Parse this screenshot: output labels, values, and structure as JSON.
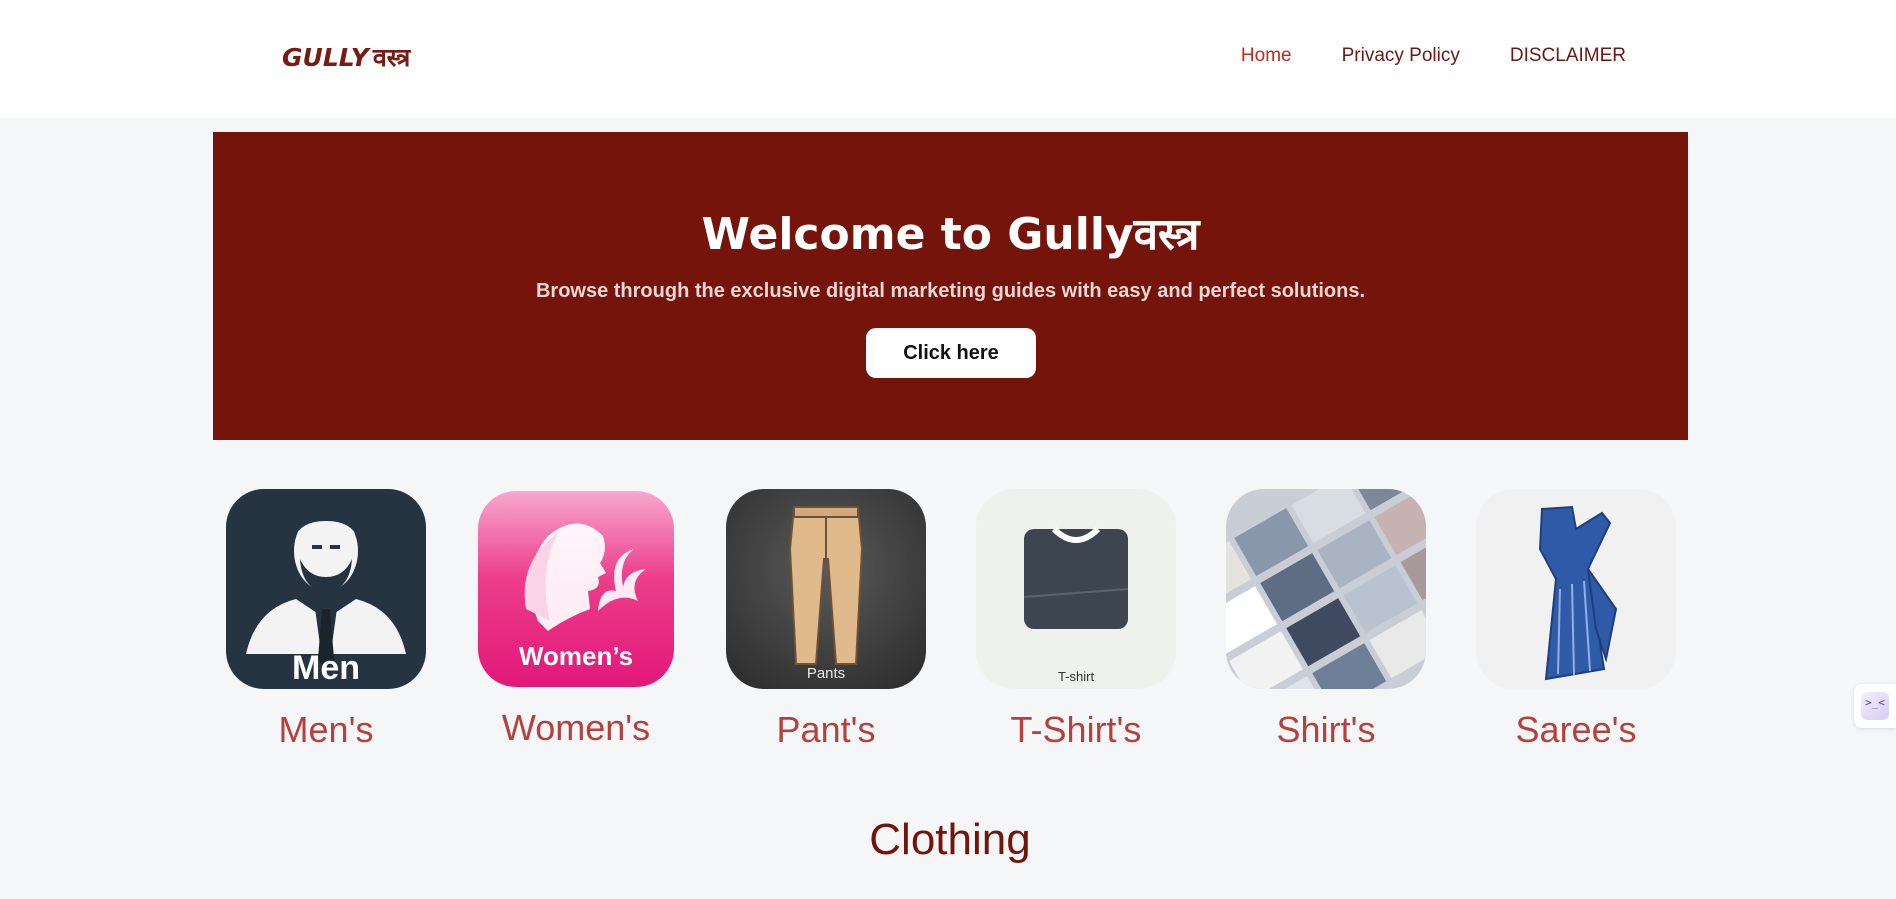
{
  "header": {
    "logo_latin": "GULLY",
    "logo_devanagari": "वस्त्र",
    "nav": [
      {
        "label": "Home",
        "active": true
      },
      {
        "label": "Privacy Policy",
        "active": false
      },
      {
        "label": "DISCLAIMER",
        "active": false
      }
    ]
  },
  "hero": {
    "title": "Welcome to Gullyवस्त्र",
    "subtitle": "Browse through the exclusive digital marketing guides with easy and perfect solutions.",
    "button_label": "Click here"
  },
  "categories": [
    {
      "label": "Men's",
      "image_caption": "Men",
      "icon": "man-suit-icon",
      "bg": "#253440"
    },
    {
      "label": "Women's",
      "image_caption": "Women’s",
      "icon": "woman-silhouette-icon",
      "bg": "#e8207a"
    },
    {
      "label": "Pant's",
      "image_caption": "Pants",
      "icon": "pants-icon",
      "bg": "#3a3a3a"
    },
    {
      "label": "T-Shirt's",
      "image_caption": "T-shirt",
      "icon": "tshirt-icon",
      "bg": "#eef1ec"
    },
    {
      "label": "Shirt's",
      "image_caption": "",
      "icon": "folded-shirts-icon",
      "bg": "#c9ced6"
    },
    {
      "label": "Saree's",
      "image_caption": "",
      "icon": "saree-icon",
      "bg": "#f1f1f2"
    }
  ],
  "section": {
    "title": "Clothing"
  },
  "colors": {
    "brand": "#74140b",
    "accent": "#c0281c",
    "category_label": "#b5403c",
    "background": "#f5f6f8"
  }
}
